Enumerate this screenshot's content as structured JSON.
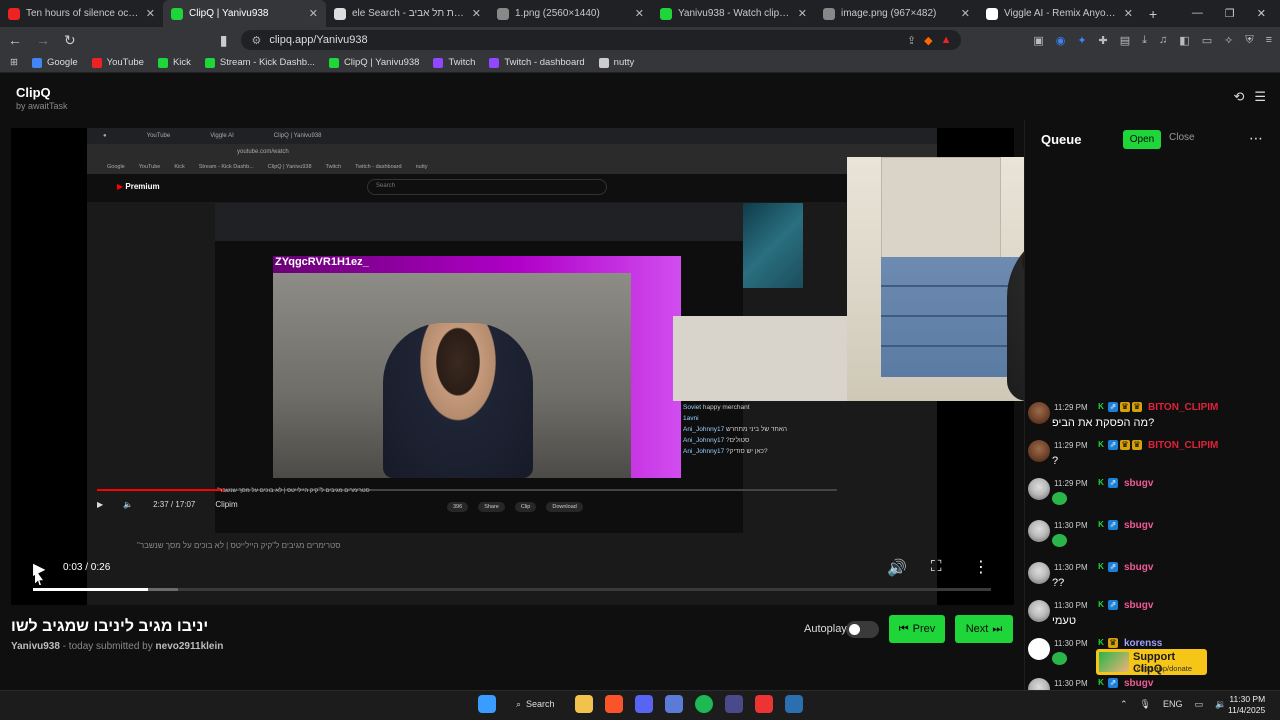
{
  "browser": {
    "tabs": [
      {
        "title": "Ten hours of silence occasionally bro",
        "color": "#e22"
      },
      {
        "title": "ClipQ | Yanivu938",
        "color": "#1fd63a"
      },
      {
        "title": "ele Search - מסעדה אתיופית תל אביב",
        "color": "#ddd"
      },
      {
        "title": "1.png (2560×1440)",
        "color": "#888"
      },
      {
        "title": "Yanivu938 - Watch clips on Kick",
        "color": "#1fd63a"
      },
      {
        "title": "image.png (967×482)",
        "color": "#888"
      },
      {
        "title": "Viggle AI - Remix Anyone into Viral",
        "color": "#fff"
      }
    ],
    "url": "clipq.app/Yanivu938",
    "bookmarks": [
      {
        "label": "Google",
        "color": "#4285f4"
      },
      {
        "label": "YouTube",
        "color": "#e22"
      },
      {
        "label": "Kick",
        "color": "#1fd63a"
      },
      {
        "label": "Stream - Kick Dashb...",
        "color": "#1fd63a"
      },
      {
        "label": "ClipQ | Yanivu938",
        "color": "#1fd63a"
      },
      {
        "label": "Twitch",
        "color": "#9146ff"
      },
      {
        "label": "Twitch - dashboard",
        "color": "#9146ff"
      },
      {
        "label": "nutty",
        "color": "#ccc"
      }
    ]
  },
  "app": {
    "name": "ClipQ",
    "by": "by awaitTask"
  },
  "player": {
    "timecode": "0:03 / 0:26",
    "progress_fraction": 0.12,
    "inner": {
      "yt_logo": "Premium",
      "search_placeholder": "Search",
      "nested_title": "ZYqgcRVR1H1ez_",
      "yt_time": "2:37 / 17:07",
      "caption": "\"סטרימרים מגיבים ל\"קיק היילייטס | לא בוכים על מסך שנשבר",
      "channel": "Clipim",
      "actions": [
        "396",
        "Share",
        "Clip",
        "Download"
      ],
      "chat": [
        {
          "user": "Soviet",
          "text": "happy merchant"
        },
        {
          "user": "1avni",
          "text": ""
        },
        {
          "user": "Ani_Johnny17",
          "text": "האחד של ביני מתחרש"
        },
        {
          "user": "Ani_Johnny17",
          "text": "?סטולים"
        },
        {
          "user": "Ani_Johnny17",
          "text": "?כאן יש סודיק?"
        }
      ]
    }
  },
  "clip": {
    "title": "יניבו מגיב ליניבו שמגיב לשו",
    "channel": "Yanivu938",
    "submitted_text": " - today submitted by ",
    "submitter": "nevo2911klein"
  },
  "controls": {
    "autoplay_label": "Autoplay",
    "autoplay_on": false,
    "prev_label": "Prev",
    "next_label": "Next"
  },
  "queue": {
    "title": "Queue",
    "open_label": "Open",
    "close_label": "Close"
  },
  "chat": [
    {
      "time": "11:29 PM",
      "user": "BITON_CLIPIM",
      "color": "#e0223a",
      "text": "מה הפסקת את הביפ?",
      "badges": [
        "kick",
        "blue",
        "gold",
        "gold"
      ],
      "avatar": "red"
    },
    {
      "time": "11:29 PM",
      "user": "BITON_CLIPIM",
      "color": "#e0223a",
      "text": "?",
      "badges": [
        "kick",
        "blue",
        "gold",
        "gold"
      ],
      "avatar": "red"
    },
    {
      "time": "11:29 PM",
      "user": "sbugv",
      "color": "#f05a96",
      "text": "",
      "emote": true,
      "badges": [
        "kick",
        "blue"
      ],
      "avatar": "gray"
    },
    {
      "time": "11:30 PM",
      "user": "sbugv",
      "color": "#f05a96",
      "text": "",
      "emote": true,
      "badges": [
        "kick",
        "blue"
      ],
      "avatar": "gray"
    },
    {
      "time": "11:30 PM",
      "user": "sbugv",
      "color": "#f05a96",
      "text": "??",
      "badges": [
        "kick",
        "blue"
      ],
      "avatar": "gray"
    },
    {
      "time": "11:30 PM",
      "user": "sbugv",
      "color": "#f05a96",
      "text": "טעמי",
      "badges": [
        "kick",
        "blue"
      ],
      "avatar": "gray"
    },
    {
      "time": "11:30 PM",
      "user": "korenss",
      "color": "#a0a0ff",
      "text": "",
      "emote": true,
      "badges": [
        "kick",
        "gold"
      ],
      "avatar": "black"
    },
    {
      "time": "11:30 PM",
      "user": "sbugv",
      "color": "#f05a96",
      "text": "",
      "emote": true,
      "badges": [
        "kick",
        "blue"
      ],
      "avatar": "gray"
    }
  ],
  "support": {
    "label": "Support ClipQ",
    "link": "clipq.app/donate"
  },
  "taskbar": {
    "search_label": "Search",
    "lang": "ENG",
    "time": "11:30 PM",
    "date": "11/4/2025"
  }
}
